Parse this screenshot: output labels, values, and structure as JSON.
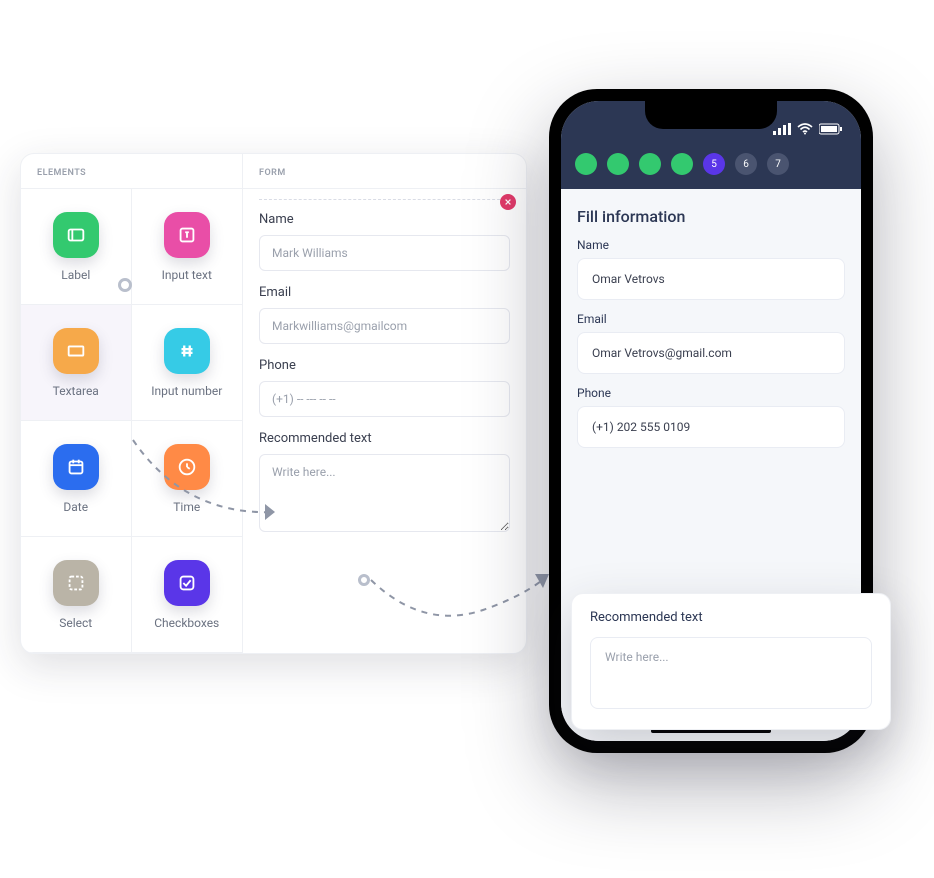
{
  "panel": {
    "elements_heading": "ELEMENTS",
    "form_heading": "FORM",
    "elements": {
      "label": "Label",
      "input_text": "Input text",
      "textarea": "Textarea",
      "input_num": "Input number",
      "date": "Date",
      "time": "Time",
      "select": "Select",
      "checkboxes": "Checkboxes"
    }
  },
  "form": {
    "name": {
      "label": "Name",
      "placeholder": "Mark Williams"
    },
    "email": {
      "label": "Email",
      "placeholder": "Markwilliams@gmailcom"
    },
    "phone": {
      "label": "Phone",
      "placeholder": "(+1) -- --- -- --"
    },
    "rec": {
      "label": "Recommended text",
      "placeholder": "Write here..."
    }
  },
  "phone": {
    "steps": {
      "s5": "5",
      "s6": "6",
      "s7": "7"
    },
    "title": "Fill information",
    "name": {
      "label": "Name",
      "value": "Omar Vetrovs"
    },
    "email": {
      "label": "Email",
      "value": "Omar Vetrovs@gmail.com"
    },
    "phone": {
      "label": "Phone",
      "value": "(+1) 202 555 0109"
    },
    "rec": {
      "label": "Recommended text",
      "placeholder": "Write here..."
    }
  }
}
